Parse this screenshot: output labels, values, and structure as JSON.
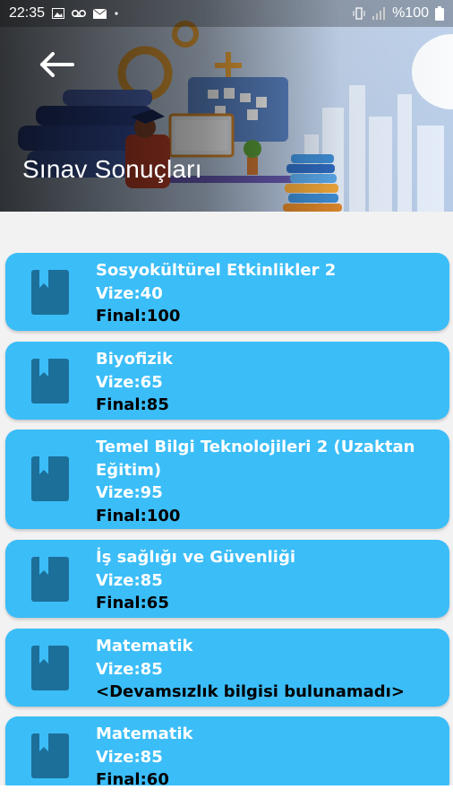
{
  "status_bar": {
    "time": "22:35",
    "battery": "%100",
    "left_icons": [
      "image-icon",
      "voicemail-icon",
      "mail-icon",
      "dot-icon"
    ],
    "right_icons": [
      "vibrate-icon",
      "signal-icon",
      "battery-icon"
    ]
  },
  "header": {
    "title": "Sınav Sonuçları",
    "back_icon": "arrow-left-icon"
  },
  "results": [
    {
      "course": "Sosyokültürel Etkinlikler 2",
      "vize": "Vize:40",
      "final": "Final:100"
    },
    {
      "course": "Biyofizik",
      "vize": "Vize:65",
      "final": "Final:85"
    },
    {
      "course": "Temel Bilgi Teknolojileri 2 (Uzaktan Eğitim)",
      "vize": "Vize:95",
      "final": "Final:100"
    },
    {
      "course": "İş sağlığı ve Güvenliği",
      "vize": "Vize:85",
      "final": "Final:65"
    },
    {
      "course": "Matematik",
      "vize": "Vize:85",
      "final": "<Devamsızlık bilgisi bulunamadı>"
    },
    {
      "course": "Matematik",
      "vize": "Vize:85",
      "final": "Final:60"
    }
  ],
  "colors": {
    "card": "#3bbdf8",
    "card_icon": "#1c6f99",
    "background": "#f2f2f2",
    "title_text": "#ffffff"
  },
  "card_icon_name": "book-icon"
}
